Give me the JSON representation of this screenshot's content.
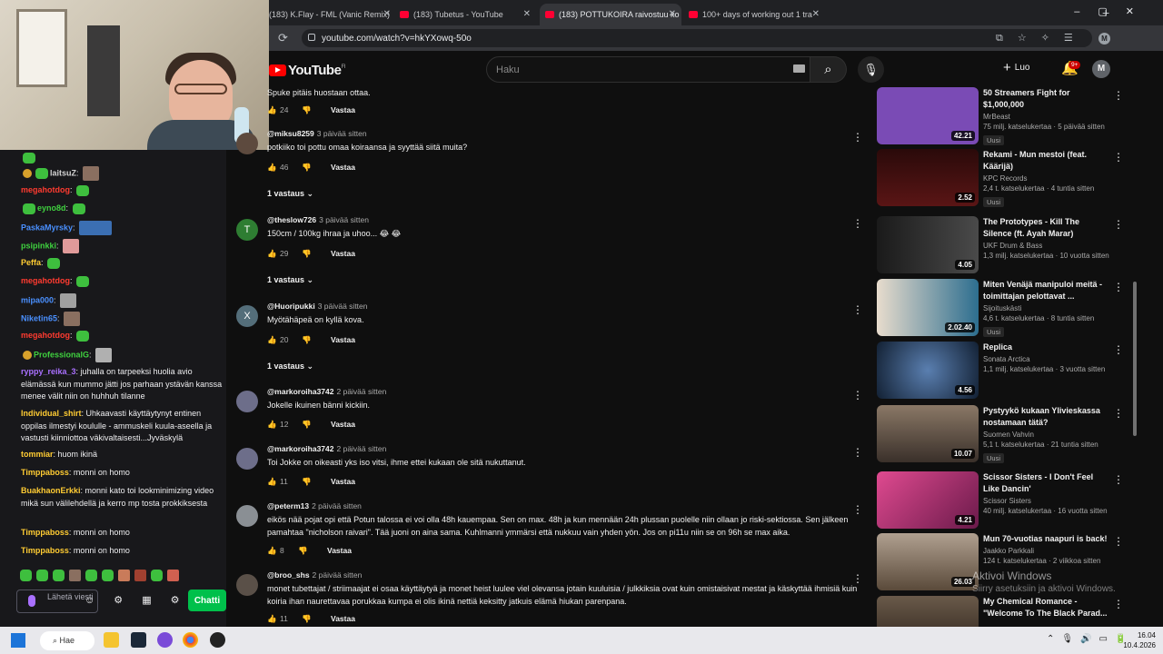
{
  "browser": {
    "tabs": [
      {
        "title": "(183) K.Flay - FML (Vanic Remix)"
      },
      {
        "title": "(183) Tubetus - YouTube"
      },
      {
        "title": "(183) POTTUKOIRA raivostuu ko"
      },
      {
        "title": "100+ days of working out 1 tra"
      }
    ],
    "url": "youtube.com/watch?v=hkYXowq-50o"
  },
  "youtube": {
    "logo": "YouTube",
    "region": "FI",
    "search_placeholder": "Haku",
    "create_label": "Luo",
    "notif_badge": "9+",
    "avatar_letter": "M"
  },
  "comments": [
    {
      "text": "Spuke pitäis huostaan ottaa.",
      "likes": "24",
      "reply": "Vastaa"
    },
    {
      "avatar": "",
      "author": "@miksu8259",
      "time": "3 päivää sitten",
      "text": "potkiiko toi pottu omaa koiraansa ja syyttää siitä muita?",
      "likes": "46",
      "reply": "Vastaa",
      "replies": "1 vastaus"
    },
    {
      "avatar": "T",
      "author": "@theslow726",
      "time": "3 päivää sitten",
      "text": "150cm / 100kg ihraa ja uhoo... 😂 😂",
      "likes": "29",
      "reply": "Vastaa",
      "replies": "1 vastaus"
    },
    {
      "avatar": "X",
      "author": "@Huoripukki",
      "time": "3 päivää sitten",
      "text": "Myötähäpeä on kyllä kova.",
      "likes": "20",
      "reply": "Vastaa",
      "replies": "1 vastaus"
    },
    {
      "avatar": "",
      "author": "@markoroiha3742",
      "time": "2 päivää sitten",
      "text": "Jokelle ikuinen bänni kickiin.",
      "likes": "12",
      "reply": "Vastaa"
    },
    {
      "avatar": "",
      "author": "@markoroiha3742",
      "time": "2 päivää sitten",
      "text": "Toi Jokke on oikeasti yks iso vitsi, ihme ettei kukaan ole sitä nukuttanut.",
      "likes": "11",
      "reply": "Vastaa"
    },
    {
      "avatar": "",
      "author": "@peterm13",
      "time": "2 päivää sitten",
      "text": "eikös nää pojat opi että Potun talossa ei voi olla 48h kauempaa. Sen on max. 48h ja kun mennään 24h plussan puolelle niin ollaan jo riski-sektiossa. Sen jälkeen pamahtaa \"nicholson raivari\". Tää juoni on aina sama. Kuhlmanni ymmärsi että nukkuu vain yhden yön. Jos on pi11u niin se on 96h se max aika.",
      "likes": "8",
      "reply": "Vastaa"
    },
    {
      "avatar": "",
      "author": "@broo_shs",
      "time": "2 päivää sitten",
      "text": "monet tubettajat / striimaajat ei osaa käyttäytyä ja monet heist luulee viel olevansa jotain kuuluisia / julkkiksia ovat kuin omistaisivat mestat ja käskyttää ihmisiä kuin koiria ihan naurettavaa porukkaa kumpa ei olis ikinä nettiä keksitty jatkuis elämä hiukan parenpana.",
      "likes": "11",
      "reply": "Vastaa"
    }
  ],
  "sidebar": [
    {
      "title": "50 Streamers Fight for $1,000,000",
      "channel": "MrBeast",
      "stats": "75 milj. katselukertaa · 5 päivää sitten",
      "badge": "Uusi",
      "duration": "42.21",
      "color": "#7a4bb5"
    },
    {
      "title": "Rekami - Mun mestoi (feat. Käärijä)",
      "channel": "KPC Records",
      "stats": "2,4 t. katselukertaa · 4 tuntia sitten",
      "badge": "Uusi",
      "duration": "2.52",
      "color": "#3a1010"
    },
    {
      "title": "The Prototypes - Kill The Silence (ft. Ayah Marar)",
      "channel": "UKF Drum & Bass",
      "stats": "1,3 milj. katselukertaa · 10 vuotta sitten",
      "badge": "",
      "duration": "4.05",
      "color": "#2a2a2a"
    },
    {
      "title": "Miten Venäjä manipuloi meitä - toimittajan pelottavat ...",
      "channel": "Sijoituskästi",
      "stats": "4,6 t. katselukertaa · 8 tuntia sitten",
      "badge": "Uusi",
      "duration": "2.02.40",
      "color": "#d5c7b8"
    },
    {
      "title": "Replica",
      "channel": "Sonata Arctica",
      "stats": "1,1 milj. katselukertaa · 3 vuotta sitten",
      "badge": "",
      "duration": "4.56",
      "color": "#223858"
    },
    {
      "title": "Pystyykö kukaan Ylivieskassa nostamaan tätä?",
      "channel": "Suomen Vahvin",
      "stats": "5,1 t. katselukertaa · 21 tuntia sitten",
      "badge": "Uusi",
      "duration": "10.07",
      "color": "#6b5a4a"
    },
    {
      "title": "Scissor Sisters - I Don't Feel Like Dancin'",
      "channel": "Scissor Sisters",
      "stats": "40 milj. katselukertaa · 16 vuotta sitten",
      "badge": "",
      "duration": "4.21",
      "color": "#c2357a"
    },
    {
      "title": "Mun 70-vuotias naapuri is back!",
      "channel": "Jaakko Parkkali",
      "stats": "124 t. katselukertaa · 2 viikkoa sitten",
      "badge": "",
      "duration": "26.03",
      "color": "#8a7a6a"
    },
    {
      "title": "My Chemical Romance - \"Welcome To The Black Parad...",
      "channel": "",
      "stats": "",
      "badge": "",
      "duration": "",
      "color": "#4a3a2a"
    }
  ],
  "chat": {
    "messages": [
      {
        "user": "laitsuZ",
        "color": "#d4d4d4",
        "text": ""
      },
      {
        "user": "megahotdog",
        "color": "#ff3b30",
        "text": ""
      },
      {
        "user": "eyno8d",
        "color": "#3fd13f",
        "text": ""
      },
      {
        "user": "PaskaMyrsky",
        "color": "#4a90ff",
        "text": ""
      },
      {
        "user": "psipinkki",
        "color": "#3fd13f",
        "text": ""
      },
      {
        "user": "Peffa",
        "color": "#ffcc33",
        "text": ""
      },
      {
        "user": "megahotdog",
        "color": "#ff3b30",
        "text": ""
      },
      {
        "user": "mipa000",
        "color": "#4a90ff",
        "text": ""
      },
      {
        "user": "Niketin65",
        "color": "#4a90ff",
        "text": ""
      },
      {
        "user": "megahotdog",
        "color": "#ff3b30",
        "text": ""
      },
      {
        "user": "ProfessionalG",
        "color": "#3fd13f",
        "text": ""
      },
      {
        "user": "ryppy_reika_3",
        "color": "#a970ff",
        "text": "juhalla on tarpeeksi huolia avio elämässä kun mummo jätti jos parhaan ystävän kanssa menee välit niin on huhhuh tilanne"
      },
      {
        "user": "Individual_shirt",
        "color": "#ffcc33",
        "text": "Uhkaavasti käyttäytynyt entinen oppilas ilmestyi koululle - ammuskeli kuula-aseella ja vastusti kiinniottoa väkivaltaisesti...Jyväskylä"
      },
      {
        "user": "tommiar",
        "color": "#ffcc33",
        "text": "huom ikinä"
      },
      {
        "user": "Timppaboss",
        "color": "#ffcc33",
        "text": "monni on homo"
      },
      {
        "user": "BuakhaonErkki",
        "color": "#ffcc33",
        "text": "monni kato toi lookminimizing video mikä sun välilehdellä ja kerro mp tosta prokkiksesta"
      },
      {
        "user": "Timppaboss",
        "color": "#ffcc33",
        "text": "monni on homo"
      },
      {
        "user": "Timppaboss",
        "color": "#ffcc33",
        "text": "monni on homo"
      }
    ],
    "input_placeholder": "Lähetä viesti",
    "send_label": "Chatti"
  },
  "watermark": {
    "line1": "Aktivoi Windows",
    "line2": "Siirry asetuksiin ja aktivoi Windows."
  },
  "taskbar": {
    "search_label": "Hae",
    "time": "16.04",
    "date": "10.4.2026"
  }
}
